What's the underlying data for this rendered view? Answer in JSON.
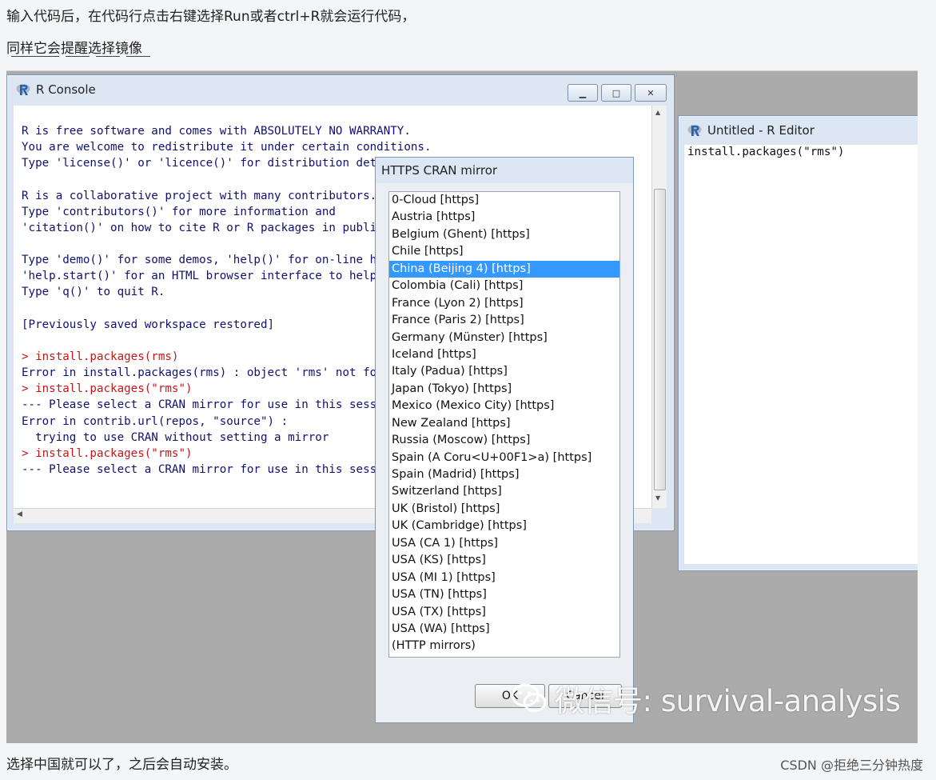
{
  "article": {
    "line1": "输入代码后，在代码行点击右键选择Run或者ctrl+R就会运行代码，",
    "line2": "同样它会提醒选择镜像",
    "line3": "选择中国就可以了，之后会自动安装。"
  },
  "console": {
    "title": "R Console",
    "lines": [
      {
        "text": "R is free software and comes with ABSOLUTELY NO WARRANTY.",
        "input": false
      },
      {
        "text": "You are welcome to redistribute it under certain conditions.",
        "input": false
      },
      {
        "text": "Type 'license()' or 'licence()' for distribution details.",
        "input": false
      },
      {
        "text": "",
        "input": false
      },
      {
        "text": "R is a collaborative project with many contributors.",
        "input": false
      },
      {
        "text": "Type 'contributors()' for more information and",
        "input": false
      },
      {
        "text": "'citation()' on how to cite R or R packages in publications.",
        "input": false
      },
      {
        "text": "",
        "input": false
      },
      {
        "text": "Type 'demo()' for some demos, 'help()' for on-line help, or",
        "input": false
      },
      {
        "text": "'help.start()' for an HTML browser interface to help.",
        "input": false
      },
      {
        "text": "Type 'q()' to quit R.",
        "input": false
      },
      {
        "text": "",
        "input": false
      },
      {
        "text": "[Previously saved workspace restored]",
        "input": false
      },
      {
        "text": "",
        "input": false
      },
      {
        "text": "> install.packages(rms)",
        "input": true
      },
      {
        "text": "Error in install.packages(rms) : object 'rms' not found",
        "input": false
      },
      {
        "text": "> install.packages(\"rms\")",
        "input": true
      },
      {
        "text": "--- Please select a CRAN mirror for use in this session ---",
        "input": false
      },
      {
        "text": "Error in contrib.url(repos, \"source\") :",
        "input": false
      },
      {
        "text": "  trying to use CRAN without setting a mirror",
        "input": false
      },
      {
        "text": "> install.packages(\"rms\")",
        "input": true
      },
      {
        "text": "--- Please select a CRAN mirror for use in this session ---",
        "input": false
      }
    ]
  },
  "editor": {
    "title": "Untitled - R Editor",
    "code": "install.packages(\"rms\")"
  },
  "dialog": {
    "title": "HTTPS CRAN mirror",
    "selected_index": 4,
    "mirrors": [
      "0-Cloud [https]",
      "Austria [https]",
      "Belgium (Ghent) [https]",
      "Chile [https]",
      "China (Beijing 4) [https]",
      "Colombia (Cali) [https]",
      "France (Lyon 2) [https]",
      "France (Paris 2) [https]",
      "Germany (Münster) [https]",
      "Iceland [https]",
      "Italy (Padua) [https]",
      "Japan (Tokyo) [https]",
      "Mexico (Mexico City) [https]",
      "New Zealand [https]",
      "Russia (Moscow) [https]",
      "Spain (A Coru<U+00F1>a) [https]",
      "Spain (Madrid) [https]",
      "Switzerland [https]",
      "UK (Bristol) [https]",
      "UK (Cambridge) [https]",
      "USA (CA 1) [https]",
      "USA (KS) [https]",
      "USA (MI 1) [https]",
      "USA (TN) [https]",
      "USA (TX) [https]",
      "USA (WA) [https]",
      "(HTTP mirrors)"
    ],
    "ok_label": "OK",
    "cancel_label": "Cancel"
  },
  "watermark": {
    "text": "微信号: survival-analysis",
    "icon": "wechat-icon"
  },
  "footer": {
    "credit": "CSDN @拒绝三分钟热度"
  },
  "colors": {
    "console_output": "#101070",
    "console_input": "#c41818",
    "selection": "#3399ff"
  }
}
